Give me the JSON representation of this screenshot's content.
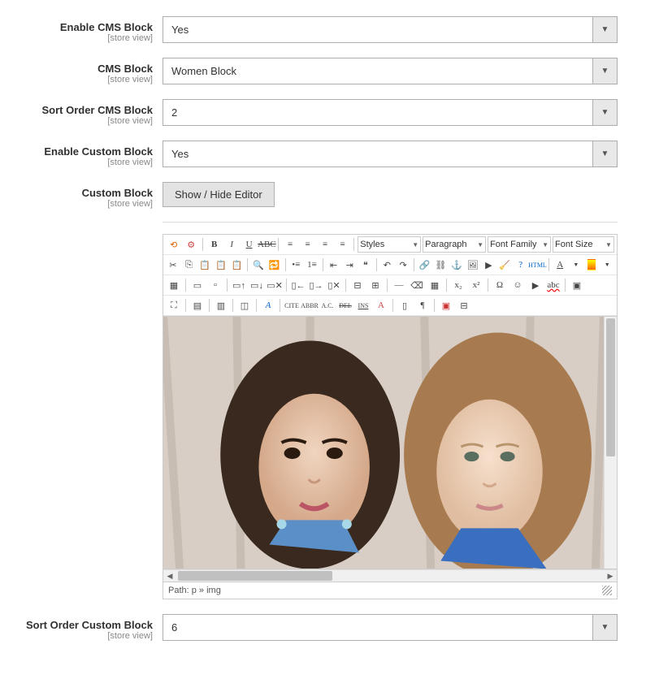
{
  "fields": {
    "enable_cms_block": {
      "label": "Enable CMS Block",
      "scope": "[store view]",
      "value": "Yes"
    },
    "cms_block": {
      "label": "CMS Block",
      "scope": "[store view]",
      "value": "Women Block"
    },
    "sort_order_cms": {
      "label": "Sort Order CMS Block",
      "scope": "[store view]",
      "value": "2"
    },
    "enable_custom_block": {
      "label": "Enable Custom Block",
      "scope": "[store view]",
      "value": "Yes"
    },
    "custom_block": {
      "label": "Custom Block",
      "scope": "[store view]"
    },
    "sort_order_custom": {
      "label": "Sort Order Custom Block",
      "scope": "[store view]",
      "value": "6"
    }
  },
  "button": {
    "toggle_editor": "Show / Hide Editor"
  },
  "toolbar": {
    "styles": "Styles",
    "format": "Paragraph",
    "font_family": "Font Family",
    "font_size": "Font Size"
  },
  "path": {
    "label": "Path:",
    "value": "p » img"
  }
}
